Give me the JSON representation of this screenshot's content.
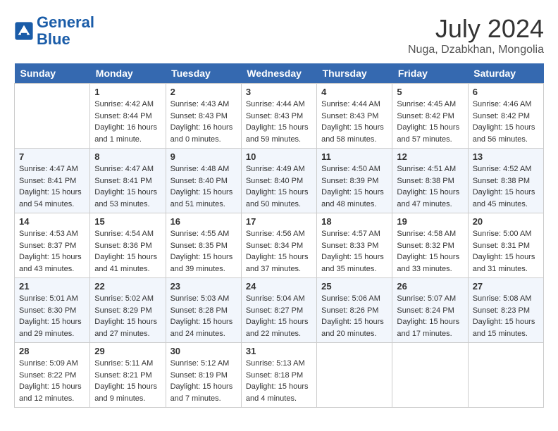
{
  "header": {
    "logo_line1": "General",
    "logo_line2": "Blue",
    "month": "July 2024",
    "location": "Nuga, Dzabkhan, Mongolia"
  },
  "days_of_week": [
    "Sunday",
    "Monday",
    "Tuesday",
    "Wednesday",
    "Thursday",
    "Friday",
    "Saturday"
  ],
  "weeks": [
    [
      {
        "num": "",
        "info": ""
      },
      {
        "num": "1",
        "info": "Sunrise: 4:42 AM\nSunset: 8:44 PM\nDaylight: 16 hours\nand 1 minute."
      },
      {
        "num": "2",
        "info": "Sunrise: 4:43 AM\nSunset: 8:43 PM\nDaylight: 16 hours\nand 0 minutes."
      },
      {
        "num": "3",
        "info": "Sunrise: 4:44 AM\nSunset: 8:43 PM\nDaylight: 15 hours\nand 59 minutes."
      },
      {
        "num": "4",
        "info": "Sunrise: 4:44 AM\nSunset: 8:43 PM\nDaylight: 15 hours\nand 58 minutes."
      },
      {
        "num": "5",
        "info": "Sunrise: 4:45 AM\nSunset: 8:42 PM\nDaylight: 15 hours\nand 57 minutes."
      },
      {
        "num": "6",
        "info": "Sunrise: 4:46 AM\nSunset: 8:42 PM\nDaylight: 15 hours\nand 56 minutes."
      }
    ],
    [
      {
        "num": "7",
        "info": "Sunrise: 4:47 AM\nSunset: 8:41 PM\nDaylight: 15 hours\nand 54 minutes."
      },
      {
        "num": "8",
        "info": "Sunrise: 4:47 AM\nSunset: 8:41 PM\nDaylight: 15 hours\nand 53 minutes."
      },
      {
        "num": "9",
        "info": "Sunrise: 4:48 AM\nSunset: 8:40 PM\nDaylight: 15 hours\nand 51 minutes."
      },
      {
        "num": "10",
        "info": "Sunrise: 4:49 AM\nSunset: 8:40 PM\nDaylight: 15 hours\nand 50 minutes."
      },
      {
        "num": "11",
        "info": "Sunrise: 4:50 AM\nSunset: 8:39 PM\nDaylight: 15 hours\nand 48 minutes."
      },
      {
        "num": "12",
        "info": "Sunrise: 4:51 AM\nSunset: 8:38 PM\nDaylight: 15 hours\nand 47 minutes."
      },
      {
        "num": "13",
        "info": "Sunrise: 4:52 AM\nSunset: 8:38 PM\nDaylight: 15 hours\nand 45 minutes."
      }
    ],
    [
      {
        "num": "14",
        "info": "Sunrise: 4:53 AM\nSunset: 8:37 PM\nDaylight: 15 hours\nand 43 minutes."
      },
      {
        "num": "15",
        "info": "Sunrise: 4:54 AM\nSunset: 8:36 PM\nDaylight: 15 hours\nand 41 minutes."
      },
      {
        "num": "16",
        "info": "Sunrise: 4:55 AM\nSunset: 8:35 PM\nDaylight: 15 hours\nand 39 minutes."
      },
      {
        "num": "17",
        "info": "Sunrise: 4:56 AM\nSunset: 8:34 PM\nDaylight: 15 hours\nand 37 minutes."
      },
      {
        "num": "18",
        "info": "Sunrise: 4:57 AM\nSunset: 8:33 PM\nDaylight: 15 hours\nand 35 minutes."
      },
      {
        "num": "19",
        "info": "Sunrise: 4:58 AM\nSunset: 8:32 PM\nDaylight: 15 hours\nand 33 minutes."
      },
      {
        "num": "20",
        "info": "Sunrise: 5:00 AM\nSunset: 8:31 PM\nDaylight: 15 hours\nand 31 minutes."
      }
    ],
    [
      {
        "num": "21",
        "info": "Sunrise: 5:01 AM\nSunset: 8:30 PM\nDaylight: 15 hours\nand 29 minutes."
      },
      {
        "num": "22",
        "info": "Sunrise: 5:02 AM\nSunset: 8:29 PM\nDaylight: 15 hours\nand 27 minutes."
      },
      {
        "num": "23",
        "info": "Sunrise: 5:03 AM\nSunset: 8:28 PM\nDaylight: 15 hours\nand 24 minutes."
      },
      {
        "num": "24",
        "info": "Sunrise: 5:04 AM\nSunset: 8:27 PM\nDaylight: 15 hours\nand 22 minutes."
      },
      {
        "num": "25",
        "info": "Sunrise: 5:06 AM\nSunset: 8:26 PM\nDaylight: 15 hours\nand 20 minutes."
      },
      {
        "num": "26",
        "info": "Sunrise: 5:07 AM\nSunset: 8:24 PM\nDaylight: 15 hours\nand 17 minutes."
      },
      {
        "num": "27",
        "info": "Sunrise: 5:08 AM\nSunset: 8:23 PM\nDaylight: 15 hours\nand 15 minutes."
      }
    ],
    [
      {
        "num": "28",
        "info": "Sunrise: 5:09 AM\nSunset: 8:22 PM\nDaylight: 15 hours\nand 12 minutes."
      },
      {
        "num": "29",
        "info": "Sunrise: 5:11 AM\nSunset: 8:21 PM\nDaylight: 15 hours\nand 9 minutes."
      },
      {
        "num": "30",
        "info": "Sunrise: 5:12 AM\nSunset: 8:19 PM\nDaylight: 15 hours\nand 7 minutes."
      },
      {
        "num": "31",
        "info": "Sunrise: 5:13 AM\nSunset: 8:18 PM\nDaylight: 15 hours\nand 4 minutes."
      },
      {
        "num": "",
        "info": ""
      },
      {
        "num": "",
        "info": ""
      },
      {
        "num": "",
        "info": ""
      }
    ]
  ]
}
